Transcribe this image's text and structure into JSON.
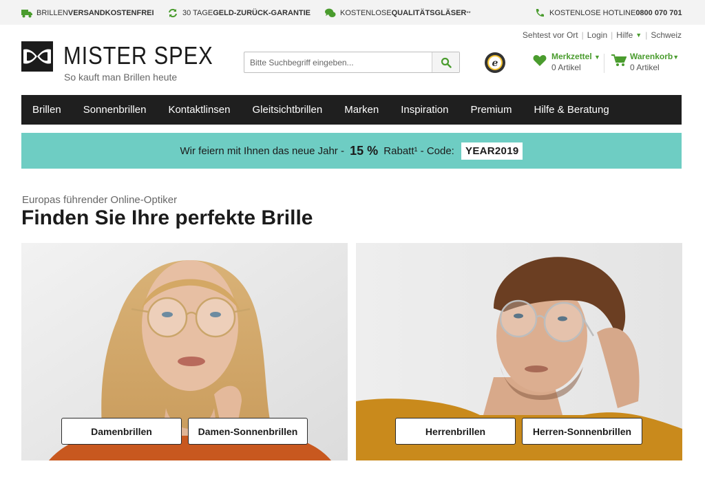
{
  "usp_bar": {
    "items": [
      {
        "icon": "truck-icon",
        "prefix": "BRILLEN ",
        "bold": "VERSANDKOSTENFREI",
        "suffix": ""
      },
      {
        "icon": "refresh-icon",
        "prefix": "30 TAGE ",
        "bold": "GELD-ZURÜCK-GARANTIE",
        "suffix": ""
      },
      {
        "icon": "chat-icon",
        "prefix": "KOSTENLOSE ",
        "bold": "QUALITÄTSGLÄSER",
        "suffix": "**"
      }
    ],
    "hotline": {
      "icon": "phone-icon",
      "label": "KOSTENLOSE HOTLINE ",
      "number": "0800 070 701"
    }
  },
  "header": {
    "logo_name": "MISTER SPEX",
    "logo_tagline": "So kauft man Brillen heute",
    "search": {
      "placeholder": "Bitte Suchbegriff eingeben...",
      "value": ""
    },
    "top_links": [
      "Sehtest vor Ort",
      "Login",
      "Hilfe",
      "Schweiz"
    ],
    "wishlist": {
      "label": "Merkzettel",
      "count": "0 Artikel"
    },
    "cart": {
      "label": "Warenkorb",
      "count": "0 Artikel"
    }
  },
  "nav": {
    "items": [
      "Brillen",
      "Sonnenbrillen",
      "Kontaktlinsen",
      "Gleitsichtbrillen",
      "Marken",
      "Inspiration",
      "Premium",
      "Hilfe & Beratung"
    ]
  },
  "promo": {
    "text_before": "Wir feiern mit Ihnen das neue Jahr - ",
    "percent": "15 %",
    "text_after": " Rabatt¹ - Code: ",
    "code": "YEAR2019"
  },
  "main": {
    "eyebrow": "Europas führender Online-Optiker",
    "headline": "Finden Sie Ihre perfekte Brille",
    "tiles": [
      {
        "buttons": [
          "Damenbrillen",
          "Damen-Sonnenbrillen"
        ]
      },
      {
        "buttons": [
          "Herrenbrillen",
          "Herren-Sonnenbrillen"
        ]
      }
    ]
  },
  "colors": {
    "brand_green": "#4a9c2e",
    "nav_bg": "#1f1f1f",
    "promo_bg": "#6ecdc3",
    "topbar_bg": "#f3f3f3"
  }
}
